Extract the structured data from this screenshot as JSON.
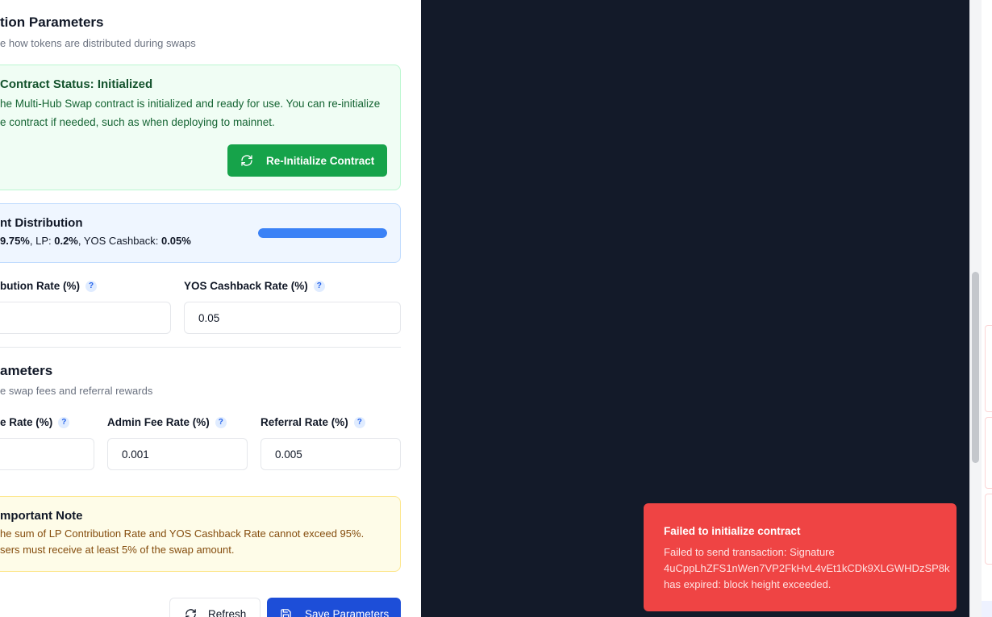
{
  "distribution": {
    "title": "tion Parameters",
    "subtitle": "e how tokens are distributed during swaps"
  },
  "contract_status": {
    "title": "Contract Status: Initialized",
    "line1": "he Multi-Hub Swap contract is initialized and ready for use. You can re-initialize",
    "line2": "e contract if needed, such as when deploying to mainnet.",
    "button_label": "Re-Initialize Contract"
  },
  "token_distribution": {
    "title": "nt Distribution",
    "user_pct": "9.75%",
    "lp_label": ", LP: ",
    "lp_pct": "0.2%",
    "cashback_label": ", YOS Cashback: ",
    "cashback_pct": "0.05%",
    "bar_fill_percent": 99.75
  },
  "rates": {
    "lp_label": "bution Rate (%)",
    "lp_value": "",
    "cashback_label": "YOS Cashback Rate (%)",
    "cashback_value": "0.05",
    "help": "?"
  },
  "fee_params": {
    "title": "ameters",
    "subtitle": "e swap fees and referral rewards",
    "swap_fee_label": "e Rate (%)",
    "swap_fee_value": "",
    "admin_fee_label": "Admin Fee Rate (%)",
    "admin_fee_value": "0.001",
    "referral_label": "Referral Rate (%)",
    "referral_value": "0.005"
  },
  "note": {
    "title": "mportant Note",
    "line1": "he sum of LP Contribution Rate and YOS Cashback Rate cannot exceed 95%.",
    "line2": "sers must receive at least 5% of the swap amount."
  },
  "actions": {
    "refresh_label": "Refresh",
    "save_label": "Save Parameters"
  },
  "toast": {
    "title": "Failed to initialize contract",
    "line1": "Failed to send transaction: Signature",
    "line2": "4uCppLhZFS1nWen7VP2FkHvL4vEt1kCDk9XLGWHDzSP8k",
    "line3": "has expired: block height exceeded."
  },
  "colors": {
    "overlay": "#131a29",
    "toast": "#ef4444",
    "primary": "#1d4ed8",
    "success": "#16a34a"
  }
}
